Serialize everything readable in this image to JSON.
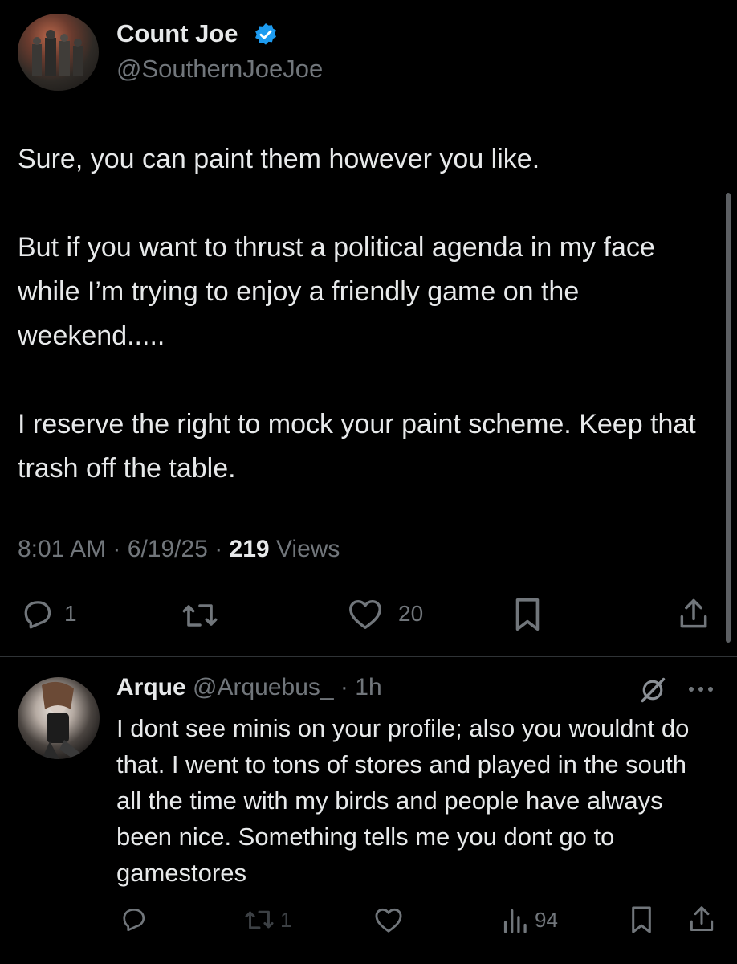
{
  "tweet": {
    "display_name": "Count Joe",
    "handle": "@SouthernJoeJoe",
    "text": "Sure, you can paint them however you like.\n\nBut if you want to thrust a political agenda in my face while I’m trying to enjoy a friendly game on the weekend.....\n\nI reserve the right to mock your paint scheme. Keep that trash off the table.",
    "time": "8:01 AM",
    "date": "6/19/25",
    "views_count": "219",
    "views_label": "Views",
    "replies": "1",
    "likes": "20"
  },
  "reply": {
    "display_name": "Arque",
    "handle": "@Arquebus_",
    "age": "1h",
    "text": "I dont see minis on your profile; also you wouldnt do that. I went to tons of stores and played in the south all the time with my birds and people have always been nice. Something tells me you dont go to gamestores",
    "retweets": "1",
    "views": "94"
  },
  "colors": {
    "background": "#000000",
    "text": "#e7e9ea",
    "muted": "#71767b",
    "verified": "#1d9bf0",
    "divider": "#2f3336"
  },
  "icons": [
    "verified-badge-icon",
    "reply-icon",
    "retweet-icon",
    "like-icon",
    "bookmark-icon",
    "share-icon",
    "grok-slash-icon",
    "more-icon",
    "views-icon"
  ]
}
